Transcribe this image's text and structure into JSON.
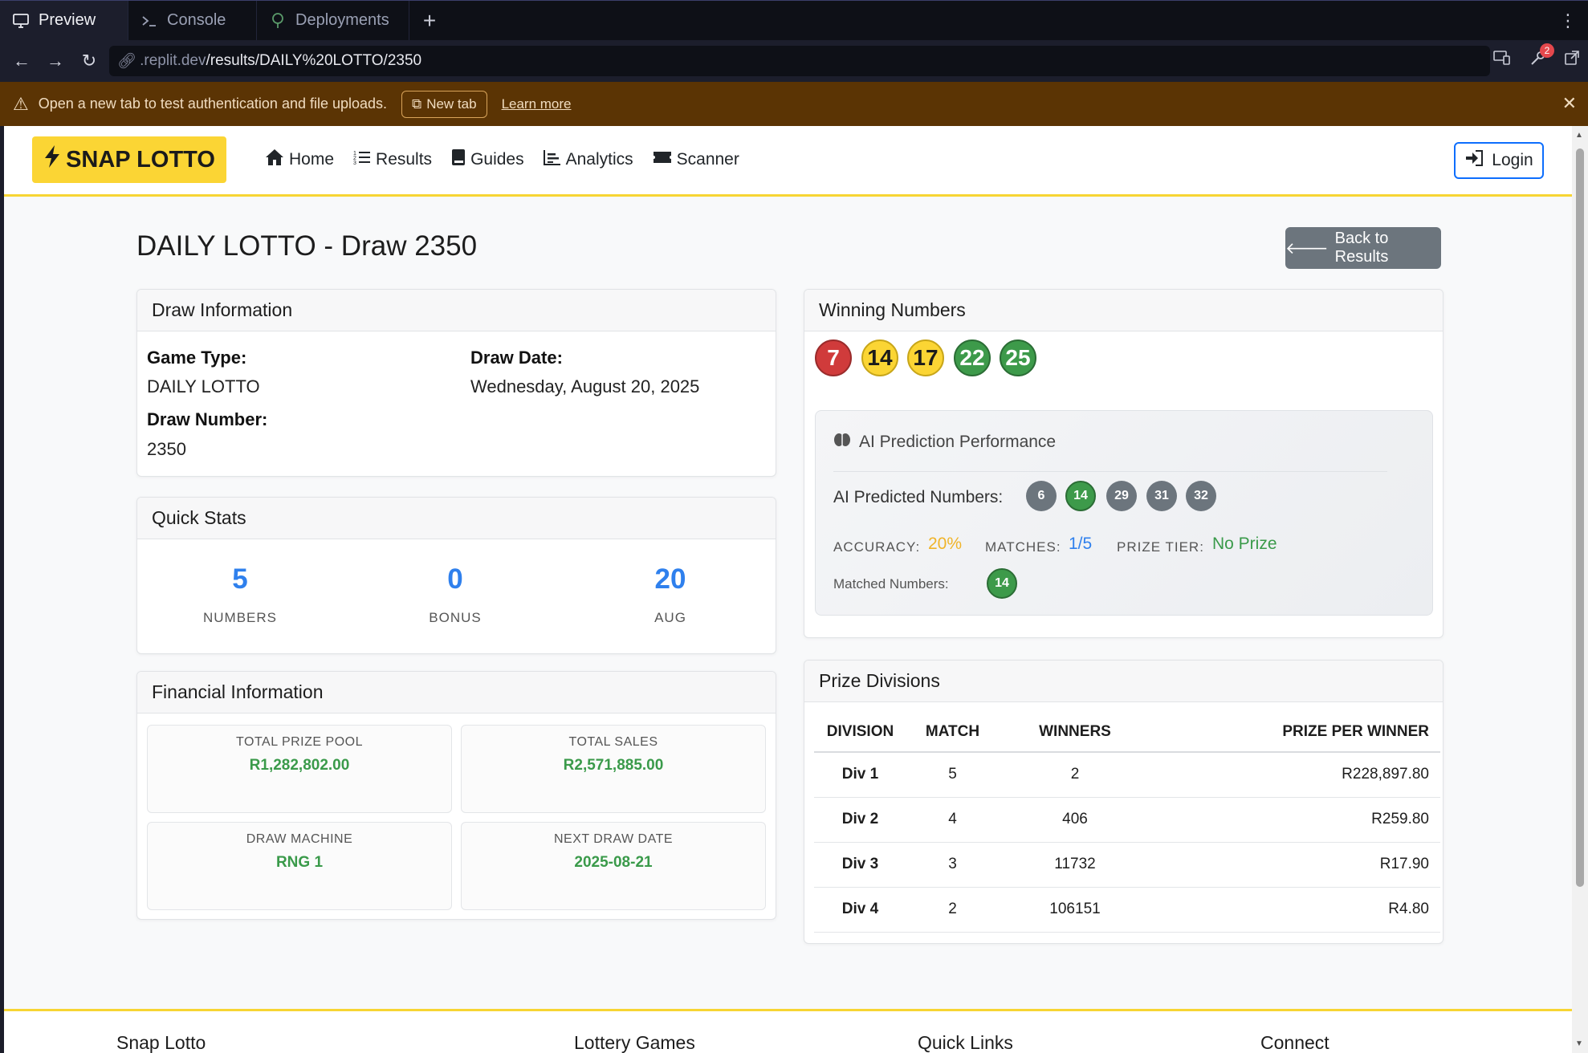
{
  "ide": {
    "tabs": [
      {
        "label": "Preview",
        "icon": "monitor-icon",
        "active": true
      },
      {
        "label": "Console",
        "icon": "terminal-icon",
        "active": false
      },
      {
        "label": "Deployments",
        "icon": "deploy-icon",
        "active": false
      }
    ],
    "url_host": ".replit.dev",
    "url_path": "/results/DAILY%20LOTTO/2350",
    "notification_count": "2",
    "warning_text": "Open a new tab to test authentication and file uploads.",
    "new_tab_label": "New tab",
    "learn_more_label": "Learn more"
  },
  "site": {
    "brand": "SNAP LOTTO",
    "nav": [
      "Home",
      "Results",
      "Guides",
      "Analytics",
      "Scanner"
    ],
    "login_label": "Login",
    "accent_color": "#fbd534"
  },
  "page": {
    "title": "DAILY LOTTO - Draw 2350",
    "back_label": "Back to Results"
  },
  "draw_info": {
    "header": "Draw Information",
    "game_type_label": "Game Type:",
    "game_type": "DAILY LOTTO",
    "draw_date_label": "Draw Date:",
    "draw_date": "Wednesday, August 20, 2025",
    "draw_number_label": "Draw Number:",
    "draw_number": "2350"
  },
  "quick_stats": {
    "header": "Quick Stats",
    "items": [
      {
        "value": "5",
        "label": "NUMBERS"
      },
      {
        "value": "0",
        "label": "BONUS"
      },
      {
        "value": "20",
        "label": "AUG"
      }
    ]
  },
  "financial": {
    "header": "Financial Information",
    "items": [
      {
        "label": "TOTAL PRIZE POOL",
        "value": "R1,282,802.00"
      },
      {
        "label": "TOTAL SALES",
        "value": "R2,571,885.00"
      },
      {
        "label": "DRAW MACHINE",
        "value": "RNG 1"
      },
      {
        "label": "NEXT DRAW DATE",
        "value": "2025-08-21"
      }
    ]
  },
  "winning": {
    "header": "Winning Numbers",
    "numbers": [
      {
        "n": "7",
        "color": "red"
      },
      {
        "n": "14",
        "color": "yellow"
      },
      {
        "n": "17",
        "color": "yellow"
      },
      {
        "n": "22",
        "color": "green"
      },
      {
        "n": "25",
        "color": "green"
      }
    ]
  },
  "ai": {
    "header": "AI Prediction Performance",
    "predicted_label": "AI Predicted Numbers:",
    "predicted": [
      {
        "n": "6",
        "matched": false
      },
      {
        "n": "14",
        "matched": true
      },
      {
        "n": "29",
        "matched": false
      },
      {
        "n": "31",
        "matched": false
      },
      {
        "n": "32",
        "matched": false
      }
    ],
    "accuracy_label": "ACCURACY:",
    "accuracy": "20%",
    "matches_label": "MATCHES:",
    "matches": "1/5",
    "prize_tier_label": "PRIZE TIER:",
    "prize_tier": "No Prize",
    "matched_label": "Matched Numbers:",
    "matched": [
      "14"
    ]
  },
  "prizes": {
    "header": "Prize Divisions",
    "columns": [
      "DIVISION",
      "MATCH",
      "WINNERS",
      "PRIZE PER WINNER"
    ],
    "rows": [
      [
        "Div 1",
        "5",
        "2",
        "R228,897.80"
      ],
      [
        "Div 2",
        "4",
        "406",
        "R259.80"
      ],
      [
        "Div 3",
        "3",
        "11732",
        "R17.90"
      ],
      [
        "Div 4",
        "2",
        "106151",
        "R4.80"
      ]
    ]
  },
  "footer": {
    "headings": [
      "Snap Lotto",
      "Lottery Games",
      "Quick Links",
      "Connect"
    ]
  }
}
